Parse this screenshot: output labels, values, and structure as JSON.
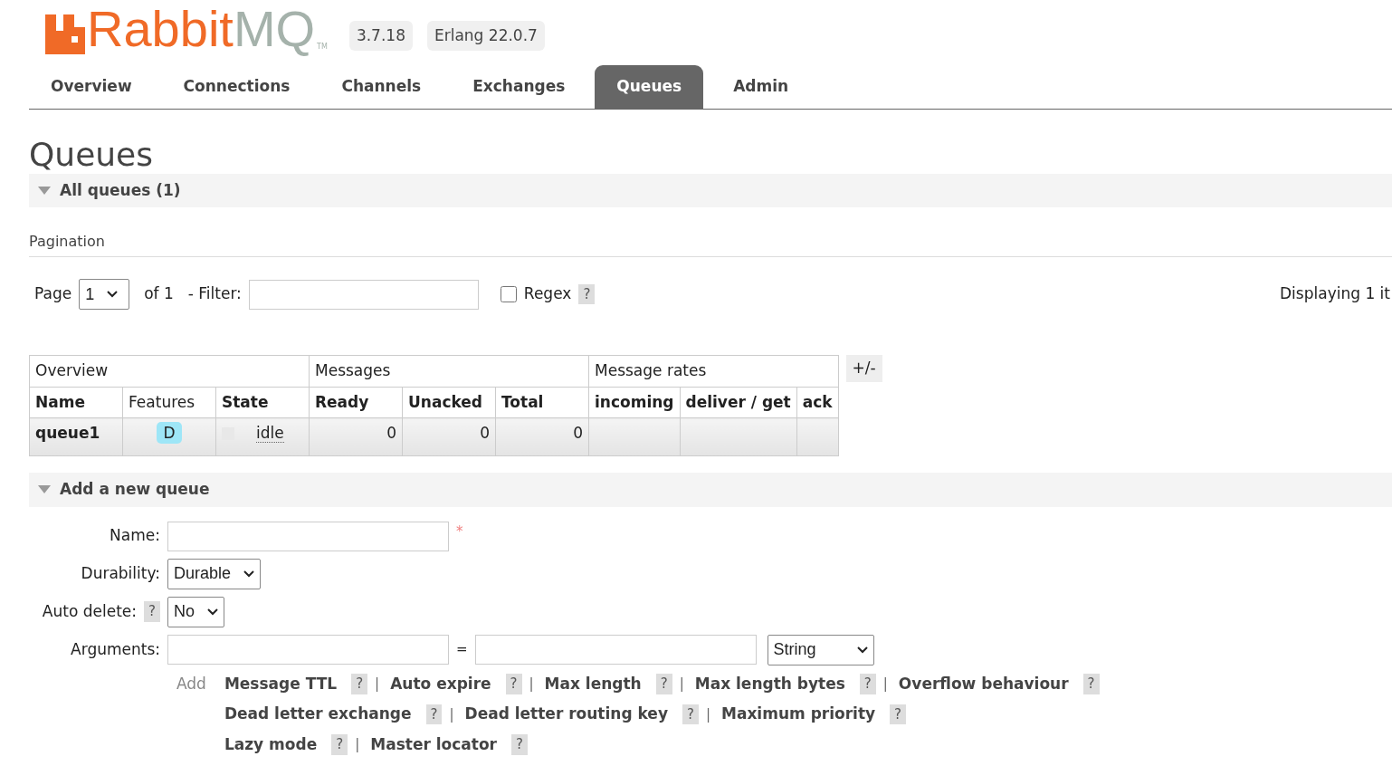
{
  "header": {
    "logo": {
      "part1": "Rabbit",
      "part2": "MQ",
      "trademark": "TM"
    },
    "badges": [
      "3.7.18",
      "Erlang 22.0.7"
    ]
  },
  "tabs": [
    {
      "label": "Overview",
      "selected": false
    },
    {
      "label": "Connections",
      "selected": false
    },
    {
      "label": "Channels",
      "selected": false
    },
    {
      "label": "Exchanges",
      "selected": false
    },
    {
      "label": "Queues",
      "selected": true
    },
    {
      "label": "Admin",
      "selected": false
    }
  ],
  "page_title": "Queues",
  "all_queues": {
    "title": "All queues (1)",
    "expanded": true
  },
  "pagination": {
    "title": "Pagination",
    "page_label": "Page",
    "page_value": "1",
    "of_label": "of 1",
    "filter_label": "- Filter:",
    "regex_label": "Regex",
    "regex_checked": false,
    "help": "?",
    "displaying": "Displaying 1 it"
  },
  "table": {
    "groups": [
      {
        "label": "Overview",
        "columns": [
          {
            "label": "Name",
            "bold": true
          },
          {
            "label": "Features",
            "bold": false
          },
          {
            "label": "State",
            "bold": true
          }
        ]
      },
      {
        "label": "Messages",
        "columns": [
          {
            "label": "Ready",
            "bold": true
          },
          {
            "label": "Unacked",
            "bold": true
          },
          {
            "label": "Total",
            "bold": true
          }
        ]
      },
      {
        "label": "Message rates",
        "columns": [
          {
            "label": "incoming",
            "bold": true
          },
          {
            "label": "deliver / get",
            "bold": true
          },
          {
            "label": "ack",
            "bold": true
          }
        ]
      }
    ],
    "toggle": "+/-",
    "rows": [
      {
        "name": "queue1",
        "feature": "D",
        "state": "idle",
        "ready": "0",
        "unacked": "0",
        "total": "0"
      }
    ]
  },
  "add_queue": {
    "title": "Add a new queue",
    "expanded": true,
    "fields": [
      {
        "kind": "text",
        "label": "Name:",
        "required": true,
        "required_mark": "*"
      },
      {
        "kind": "select",
        "label": "Durability:",
        "value": "Durable"
      },
      {
        "kind": "select",
        "label": "Auto delete:",
        "value": "No",
        "help": "?"
      },
      {
        "kind": "arguments",
        "label": "Arguments:",
        "equals": "=",
        "type": "String"
      }
    ],
    "add_label": "Add",
    "shortcut_lines": [
      [
        {
          "label": "Message TTL",
          "help": "?"
        },
        {
          "label": "Auto expire",
          "help": "?"
        },
        {
          "label": "Max length",
          "help": "?"
        },
        {
          "label": "Max length bytes",
          "help": "?"
        },
        {
          "label": "Overflow behaviour",
          "help": "?"
        }
      ],
      [
        {
          "label": "Dead letter exchange",
          "help": "?"
        },
        {
          "label": "Dead letter routing key",
          "help": "?"
        },
        {
          "label": "Maximum priority",
          "help": "?"
        }
      ],
      [
        {
          "label": "Lazy mode",
          "help": "?"
        },
        {
          "label": "Master locator",
          "help": "?"
        }
      ]
    ],
    "separator": "|"
  }
}
